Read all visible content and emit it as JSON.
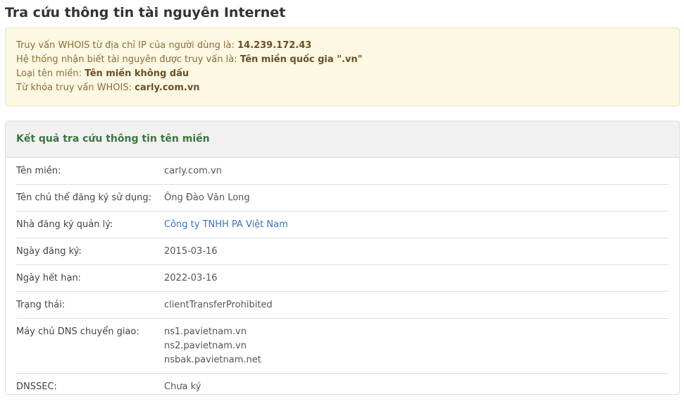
{
  "page_title": "Tra cứu thông tin tài nguyên Internet",
  "info": {
    "ip_label": "Truy vấn WHOIS từ địa chỉ IP của người dùng là: ",
    "ip_value": "14.239.172.43",
    "resource_label": "Hệ thống nhận biết tài nguyên được truy vấn là: ",
    "resource_value": "Tên miền quốc gia \".vn\"",
    "domain_type_label": "Loại tên miền: ",
    "domain_type_value": "Tên miền không dấu",
    "keyword_label": "Từ khóa truy vấn WHOIS: ",
    "keyword_value": "carly.com.vn"
  },
  "panel": {
    "title": "Kết quả tra cứu thông tin tên miền",
    "rows": [
      {
        "label": "Tên miền:",
        "value": "carly.com.vn"
      },
      {
        "label": "Tên chủ thể đăng ký sử dụng:",
        "value": "Ông Đào Văn Long"
      },
      {
        "label": "Nhà đăng ký quản lý:",
        "value": "Công ty TNHH PA Việt Nam"
      },
      {
        "label": "Ngày đăng ký:",
        "value": "2015-03-16"
      },
      {
        "label": "Ngày hết hạn:",
        "value": "2022-03-16"
      },
      {
        "label": "Trạng thái:",
        "value": "clientTransferProhibited"
      },
      {
        "label": "Máy chủ DNS chuyển giao:",
        "values": [
          "ns1.pavietnam.vn",
          "ns2.pavietnam.vn",
          "nsbak.pavietnam.net"
        ]
      },
      {
        "label": "DNSSEC:",
        "value": "Chưa ký"
      }
    ]
  }
}
